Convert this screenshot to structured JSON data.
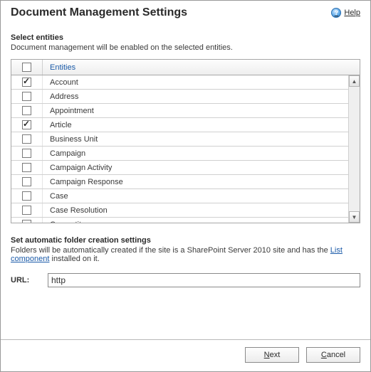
{
  "title": "Document Management Settings",
  "help_label": "Help",
  "select_entities": {
    "heading": "Select entities",
    "description": "Document management will be enabled on the selected entities.",
    "column_header": "Entities",
    "header_checked": false,
    "rows": [
      {
        "label": "Account",
        "checked": true
      },
      {
        "label": "Address",
        "checked": false
      },
      {
        "label": "Appointment",
        "checked": false
      },
      {
        "label": "Article",
        "checked": true
      },
      {
        "label": "Business Unit",
        "checked": false
      },
      {
        "label": "Campaign",
        "checked": false
      },
      {
        "label": "Campaign Activity",
        "checked": false
      },
      {
        "label": "Campaign Response",
        "checked": false
      },
      {
        "label": "Case",
        "checked": false
      },
      {
        "label": "Case Resolution",
        "checked": false
      },
      {
        "label": "Competitor",
        "checked": false
      }
    ]
  },
  "folder_settings": {
    "heading": "Set automatic folder creation settings",
    "desc_before": "Folders will be automatically created if the site is a SharePoint Server 2010 site and has the ",
    "link_text": "List component",
    "desc_after": " installed on it."
  },
  "url": {
    "label": "URL:",
    "value": "http"
  },
  "buttons": {
    "next_u": "N",
    "next_rest": "ext",
    "cancel_u": "C",
    "cancel_rest": "ancel"
  }
}
